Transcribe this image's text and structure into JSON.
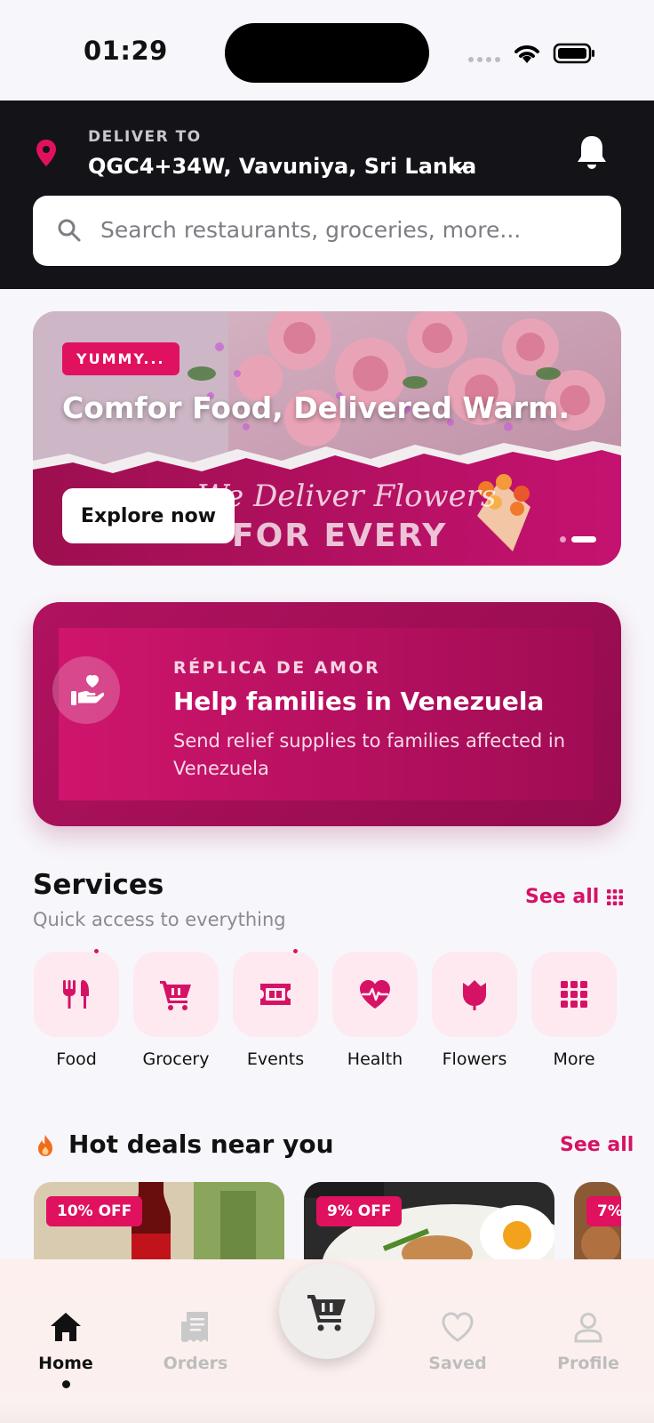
{
  "status_bar": {
    "time": "01:29"
  },
  "header": {
    "deliver_label": "DELIVER TO",
    "address": "QGC4+34W, Vavuniya, Sri Lanka",
    "search_placeholder": "Search restaurants, groceries, more..."
  },
  "banner": {
    "tag": "YUMMY...",
    "title": "Comfor Food, Delivered Warm.",
    "image_text_script": "We Deliver Flowers",
    "image_text_big": "FOR EVERY",
    "cta": "Explore now",
    "slides": 2,
    "active_slide": 2
  },
  "charity": {
    "kicker": "RÉPLICA DE AMOR",
    "title": "Help families in Venezuela",
    "description": "Send relief supplies to families affected in Venezuela"
  },
  "services": {
    "title": "Services",
    "subtitle": "Quick access to everything",
    "see_all": "See all",
    "items": [
      {
        "label": "Food",
        "icon": "utensils-icon",
        "badge": true
      },
      {
        "label": "Grocery",
        "icon": "cart-icon",
        "badge": false
      },
      {
        "label": "Events",
        "icon": "ticket-icon",
        "badge": true
      },
      {
        "label": "Health",
        "icon": "heartbeat-icon",
        "badge": false
      },
      {
        "label": "Flowers",
        "icon": "tulip-icon",
        "badge": false
      },
      {
        "label": "More",
        "icon": "grid-icon",
        "badge": false
      }
    ]
  },
  "deals": {
    "title": "Hot deals near you",
    "see_all": "See all",
    "items": [
      {
        "badge": "10% OFF"
      },
      {
        "badge": "9% OFF"
      },
      {
        "badge": "7%"
      }
    ]
  },
  "bottom_nav": {
    "items": [
      {
        "label": "Home",
        "active": true
      },
      {
        "label": "Orders",
        "active": false
      },
      {
        "label": "Saved",
        "active": false
      },
      {
        "label": "Profile",
        "active": false
      }
    ]
  },
  "colors": {
    "accent": "#e0115f",
    "header_bg": "#141418",
    "charity_bg": "#a10c55"
  }
}
